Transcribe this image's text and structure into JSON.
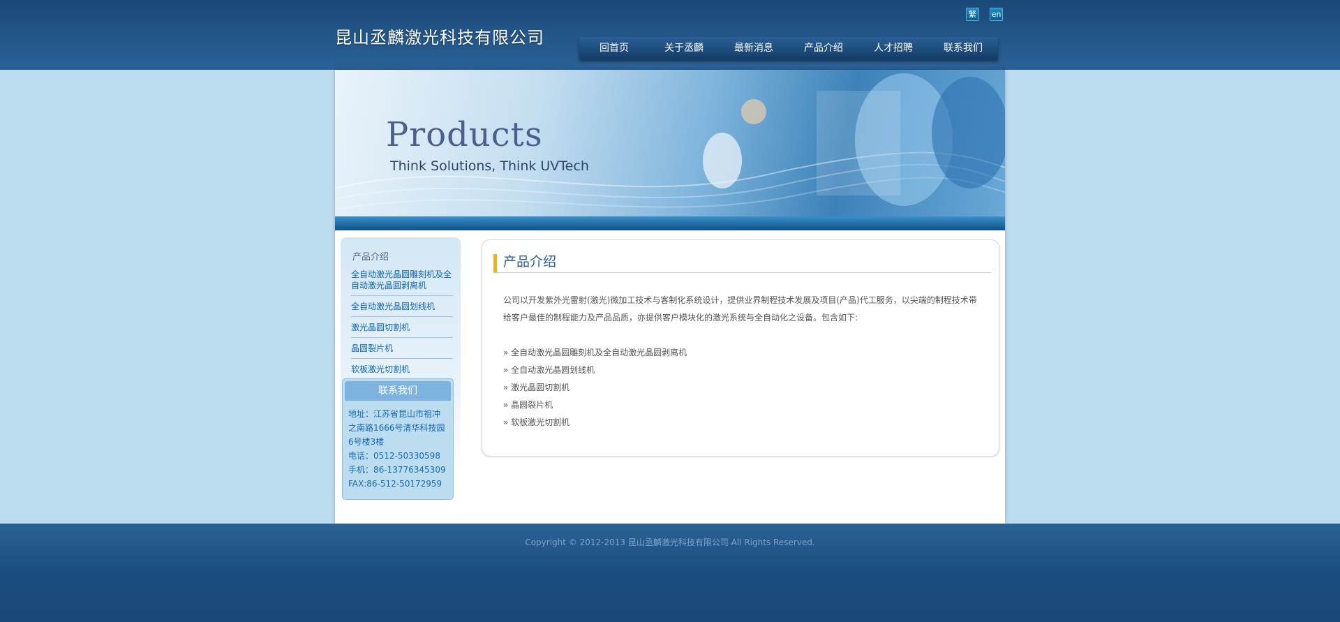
{
  "header": {
    "logo": "昆山丞麟激光科技有限公司",
    "lang_traditional": "繁",
    "lang_english": "en",
    "nav": [
      "回首页",
      "关于丞麟",
      "最新消息",
      "产品介绍",
      "人才招聘",
      "联系我们"
    ]
  },
  "banner": {
    "title": "Products",
    "subtitle": "Think Solutions, Think UVTech"
  },
  "sidebar": {
    "title": "产品介绍",
    "items": [
      "全自动激光晶圆雕刻机及全自动激光晶圆剥离机",
      "全自动激光晶圆划线机",
      "激光晶圆切割机",
      "晶圆裂片机",
      "软板激光切割机"
    ],
    "contact": {
      "title": "联系我们",
      "address": "地址：江苏省昆山市祖冲之南路1666号清华科技园6号楼3楼",
      "phone": "电话：0512-50330598",
      "mobile": "手机：86-13776345309",
      "fax": "FAX:86-512-50172959"
    }
  },
  "content": {
    "title": "产品介绍",
    "description": "公司以开发紫外光雷射(激光)微加工技术与客制化系统设计，提供业界制程技术发展及项目(产品)代工服务，以尖端的制程技术带给客户最佳的制程能力及产品品质，亦提供客户模块化的激光系统与全自动化之设备。包含如下:",
    "products": [
      "» 全自动激光晶圆雕刻机及全自动激光晶圆剥离机",
      "» 全自动激光晶圆划线机",
      "» 激光晶圆切割机",
      "» 晶圆裂片机",
      "» 软板激光切割机"
    ]
  },
  "footer": {
    "copyright": "Copyright © 2012-2013 昆山丞麟激光科技有限公司 All Rights Reserved."
  }
}
